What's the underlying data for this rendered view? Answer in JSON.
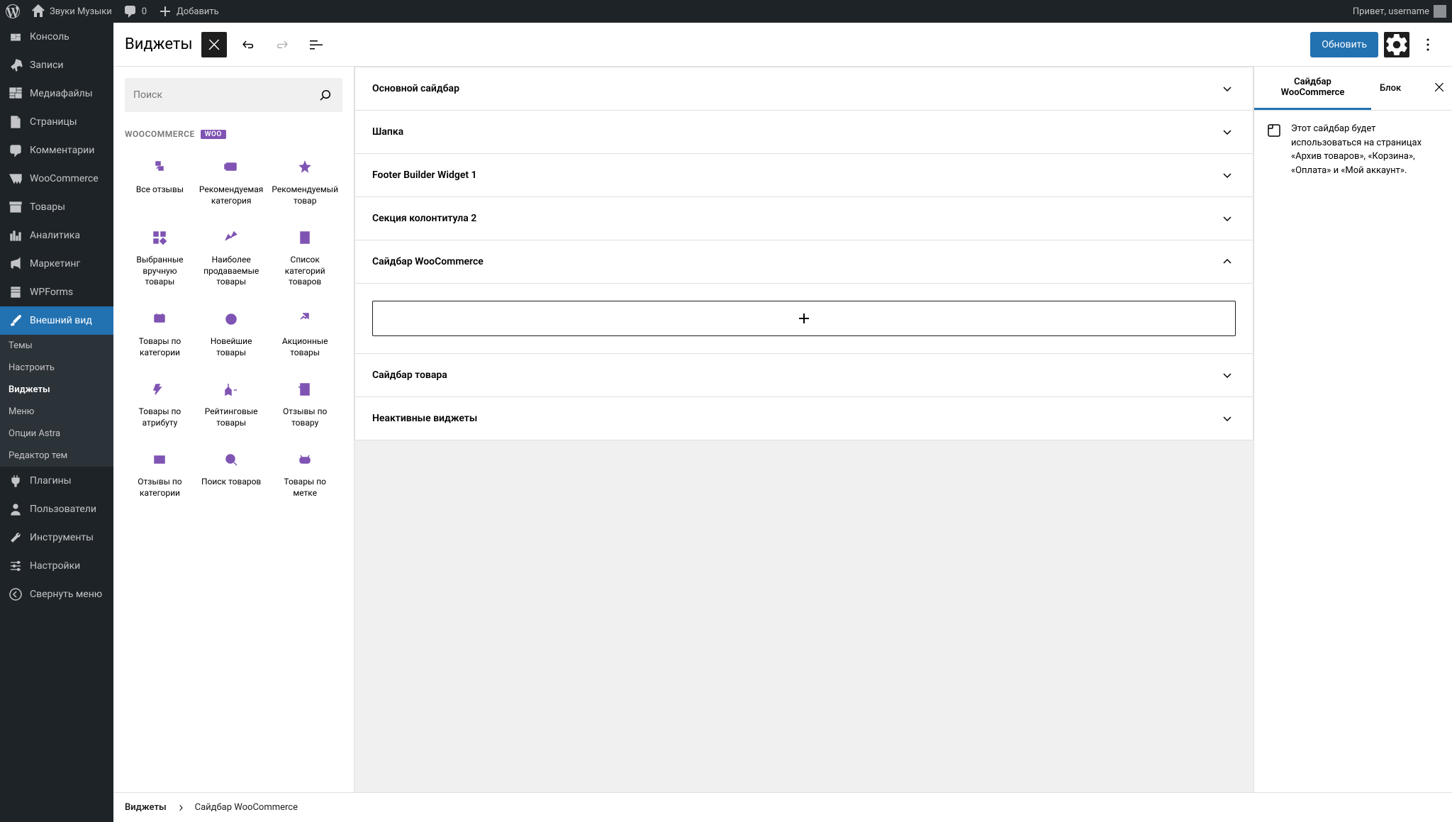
{
  "topbar": {
    "site_title": "Звуки Музыки",
    "comments": "0",
    "add": "Добавить",
    "greeting": "Привет, username"
  },
  "sidebar": {
    "items": [
      {
        "label": "Консоль",
        "icon": "dashboard"
      },
      {
        "label": "Записи",
        "icon": "pin"
      },
      {
        "label": "Медиафайлы",
        "icon": "media"
      },
      {
        "label": "Страницы",
        "icon": "page"
      },
      {
        "label": "Комментарии",
        "icon": "comment"
      },
      {
        "label": "WooCommerce",
        "icon": "woo"
      },
      {
        "label": "Товары",
        "icon": "archive"
      },
      {
        "label": "Аналитика",
        "icon": "chart"
      },
      {
        "label": "Маркетинг",
        "icon": "megaphone"
      },
      {
        "label": "WPForms",
        "icon": "forms"
      },
      {
        "label": "Внешний вид",
        "icon": "brush",
        "active": true
      },
      {
        "label": "Плагины",
        "icon": "plugin"
      },
      {
        "label": "Пользователи",
        "icon": "user"
      },
      {
        "label": "Инструменты",
        "icon": "tools"
      },
      {
        "label": "Настройки",
        "icon": "settings"
      }
    ],
    "sub_items": [
      "Темы",
      "Настроить",
      "Виджеты",
      "Меню",
      "Опции Astra",
      "Редактор тем"
    ],
    "sub_active_index": 2,
    "collapse": "Свернуть меню"
  },
  "editor": {
    "title": "Виджеты",
    "update_btn": "Обновить"
  },
  "block_panel": {
    "search_placeholder": "Поиск",
    "category": "WOOCOMMERCE",
    "blocks": [
      "Все отзывы",
      "Рекомендуемая категория",
      "Рекомендуемый товар",
      "Выбранные вручную товары",
      "Наиболее продаваемые товары",
      "Список категорий товаров",
      "Товары по категории",
      "Новейшие товары",
      "Акционные товары",
      "Товары по атрибуту",
      "Рейтинговые товары",
      "Отзывы по товару",
      "Отзывы по категории",
      "Поиск товаров",
      "Товары по метке"
    ]
  },
  "widget_areas": [
    {
      "label": "Основной сайдбар",
      "open": false
    },
    {
      "label": "Шапка",
      "open": false
    },
    {
      "label": "Footer Builder Widget 1",
      "open": false
    },
    {
      "label": "Секция колонтитула 2",
      "open": false
    },
    {
      "label": "Сайдбар WooCommerce",
      "open": true
    },
    {
      "label": "Сайдбар товара",
      "open": false
    },
    {
      "label": "Неактивные виджеты",
      "open": false
    }
  ],
  "settings": {
    "tab1": "Сайдбар WooCommerce",
    "tab2": "Блок",
    "description": "Этот сайдбар будет использоваться на страницах «Архив товаров», «Корзина», «Оплата» и «Мой аккаунт»."
  },
  "breadcrumb": {
    "root": "Виджеты",
    "current": "Сайдбар WooCommerce"
  }
}
